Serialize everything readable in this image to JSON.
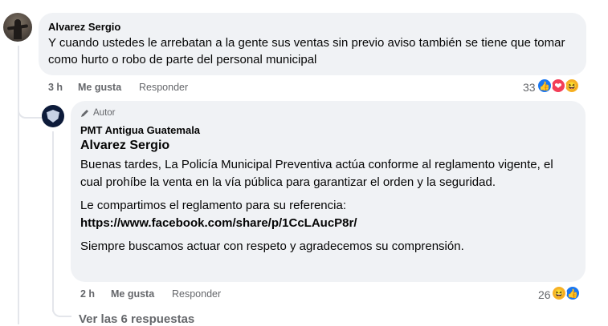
{
  "comment1": {
    "author": "Alvarez Sergio",
    "text": "Y cuando ustedes le arrebatan a la gente sus ventas sin previo aviso también se tiene que tomar como hurto o robo de parte del personal municipal",
    "time": "3 h",
    "like_label": "Me gusta",
    "reply_label": "Responder",
    "reaction_count": "33",
    "reactions": [
      "like",
      "love",
      "haha"
    ]
  },
  "reply1": {
    "badge": "Autor",
    "author": "PMT Antigua Guatemala",
    "mention": "Alvarez Sergio",
    "para1": "Buenas tardes, La Policía Municipal Preventiva actúa conforme al reglamento vigente, el cual prohíbe la venta en la vía pública para garantizar el orden y la seguridad.",
    "para2_intro": "Le compartimos el reglamento para su referencia:",
    "para2_link": "https://www.facebook.com/share/p/1CcLAucP8r/",
    "para3": "Siempre buscamos actuar con respeto y agradecemos su comprensión.",
    "time": "2 h",
    "like_label": "Me gusta",
    "reply_label": "Responder",
    "reaction_count": "26",
    "reactions": [
      "haha",
      "like"
    ]
  },
  "view_replies": "Ver las 6 respuestas",
  "colors": {
    "like": "#1877f2",
    "love": "#f33e58",
    "haha": "#f7b125",
    "bubble": "#f0f2f5",
    "meta": "#65676b"
  }
}
